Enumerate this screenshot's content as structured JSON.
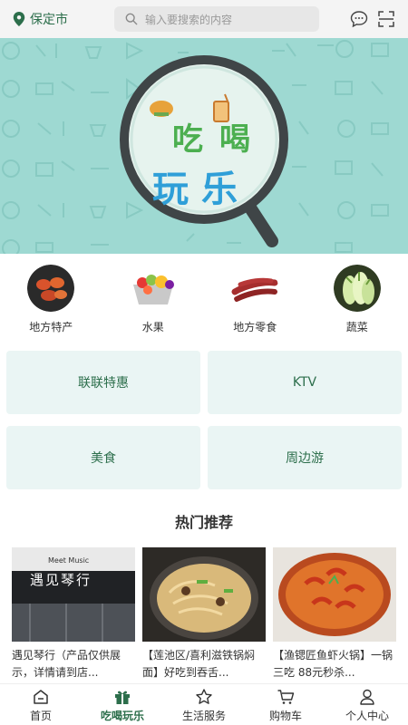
{
  "header": {
    "city": "保定市",
    "search_placeholder": "输入要搜索的内容"
  },
  "banner": {
    "line1": "吃喝",
    "line2": "玩乐"
  },
  "categories": [
    {
      "label": "地方特产",
      "icon": "crab-image"
    },
    {
      "label": "水果",
      "icon": "fruit-basket-image"
    },
    {
      "label": "地方零食",
      "icon": "sausage-image"
    },
    {
      "label": "蔬菜",
      "icon": "cabbage-image"
    }
  ],
  "tiles": [
    {
      "label": "联联特惠"
    },
    {
      "label": "KTV"
    },
    {
      "label": "美食"
    },
    {
      "label": "周边游"
    }
  ],
  "hot": {
    "title": "热门推荐",
    "items": [
      {
        "title": "遇见琴行（产品仅供展示，详情请到店..."
      },
      {
        "title": "【莲池区/喜利滋铁锅焖面】好吃到吞舌..."
      },
      {
        "title": "【渔锶匠鱼虾火锅】一锅三吃 88元秒杀..."
      }
    ],
    "sign_text": "遇见琴行",
    "sign_sub": "Meet Music"
  },
  "tabbar": [
    {
      "label": "首页",
      "icon": "home-icon",
      "active": false
    },
    {
      "label": "吃喝玩乐",
      "icon": "gift-icon",
      "active": true
    },
    {
      "label": "生活服务",
      "icon": "star-icon",
      "active": false
    },
    {
      "label": "购物车",
      "icon": "cart-icon",
      "active": false
    },
    {
      "label": "个人中心",
      "icon": "user-icon",
      "active": false
    }
  ],
  "colors": {
    "brand": "#2c6e4b",
    "banner_bg": "#9ed9d2",
    "tile_bg": "#eaf5f4"
  }
}
